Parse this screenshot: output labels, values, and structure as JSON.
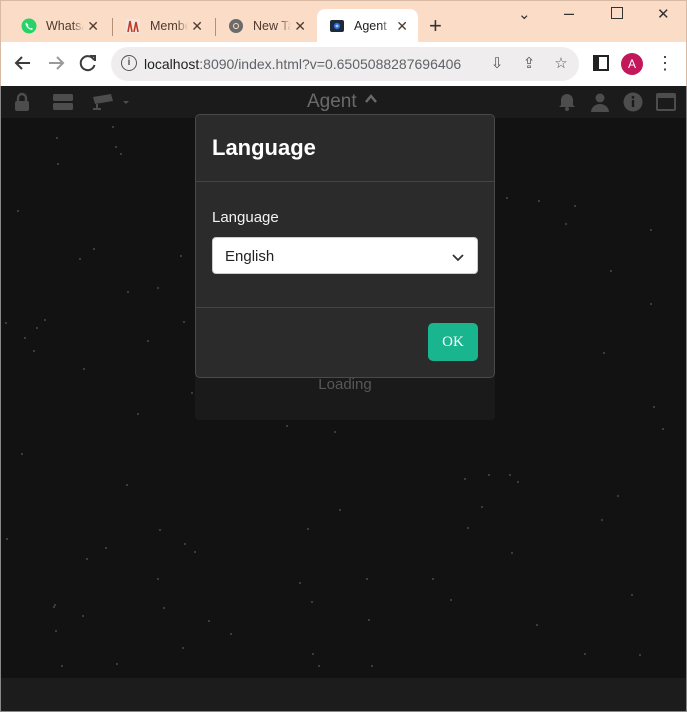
{
  "browser": {
    "tabs": [
      {
        "title": "WhatsApp",
        "icon": "whatsapp-icon"
      },
      {
        "title": "Members",
        "icon": "members-favicon"
      },
      {
        "title": "New Tab",
        "icon": "chrome-icon"
      },
      {
        "title": "Agent",
        "icon": "agent-favicon",
        "active": true
      }
    ],
    "url_host": "localhost",
    "url_rest": ":8090/index.html?v=0.6505088287696406",
    "profile_initial": "A"
  },
  "app": {
    "title": "Agent",
    "loading_text": "Loading"
  },
  "modal": {
    "title": "Language",
    "field_label": "Language",
    "selected_language": "English",
    "ok_label": "OK"
  },
  "colors": {
    "accent": "#19b58e",
    "avatar": "#c2185b",
    "tabstrip": "#fbdcc6"
  }
}
